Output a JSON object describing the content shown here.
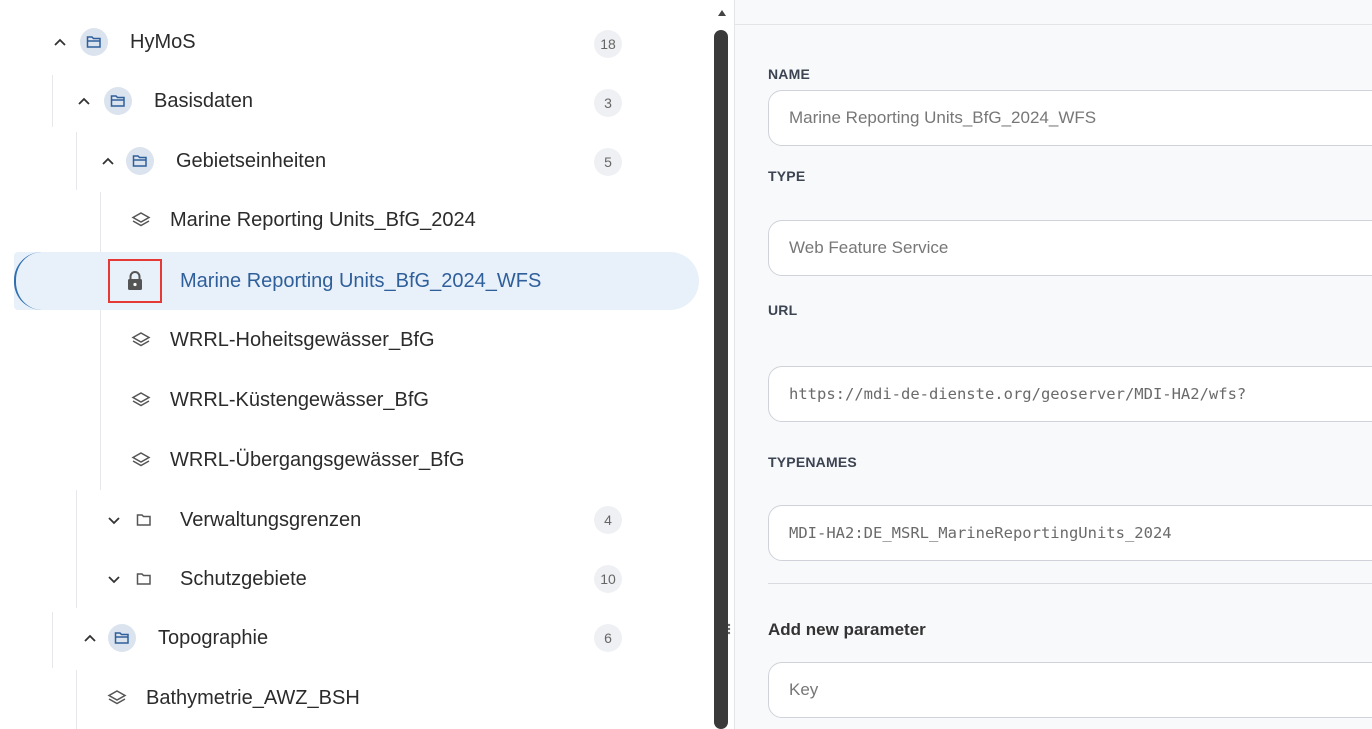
{
  "tree": {
    "hymos": {
      "label": "HyMoS",
      "count": "18"
    },
    "basisdaten": {
      "label": "Basisdaten",
      "count": "3"
    },
    "gebietseinheiten": {
      "label": "Gebietseinheiten",
      "count": "5"
    },
    "layers": [
      {
        "label": "Marine Reporting Units_BfG_2024"
      },
      {
        "label": "Marine Reporting Units_BfG_2024_WFS"
      },
      {
        "label": "WRRL-Hoheitsgewässer_BfG"
      },
      {
        "label": "WRRL-Küstengewässer_BfG"
      },
      {
        "label": "WRRL-Übergangsgewässer_BfG"
      }
    ],
    "verwaltungsgrenzen": {
      "label": "Verwaltungsgrenzen",
      "count": "4"
    },
    "schutzgebiete": {
      "label": "Schutzgebiete",
      "count": "10"
    },
    "topographie": {
      "label": "Topographie",
      "count": "6"
    },
    "bathymetrie": {
      "label": "Bathymetrie_AWZ_BSH"
    }
  },
  "form": {
    "name_label": "NAME",
    "name_value": "Marine Reporting Units_BfG_2024_WFS",
    "type_label": "TYPE",
    "type_value": "Web Feature Service",
    "url_label": "URL",
    "url_value": "https://mdi-de-dienste.org/geoserver/MDI-HA2/wfs?",
    "typenames_label": "TYPENAMES",
    "typenames_value": "MDI-HA2:DE_MSRL_MarineReportingUnits_2024",
    "add_param_label": "Add new parameter",
    "key_placeholder": "Key"
  },
  "colors": {
    "accent": "#2f6fb0",
    "highlight_box": "#e53935",
    "selected_bg": "#e8f1fa"
  }
}
